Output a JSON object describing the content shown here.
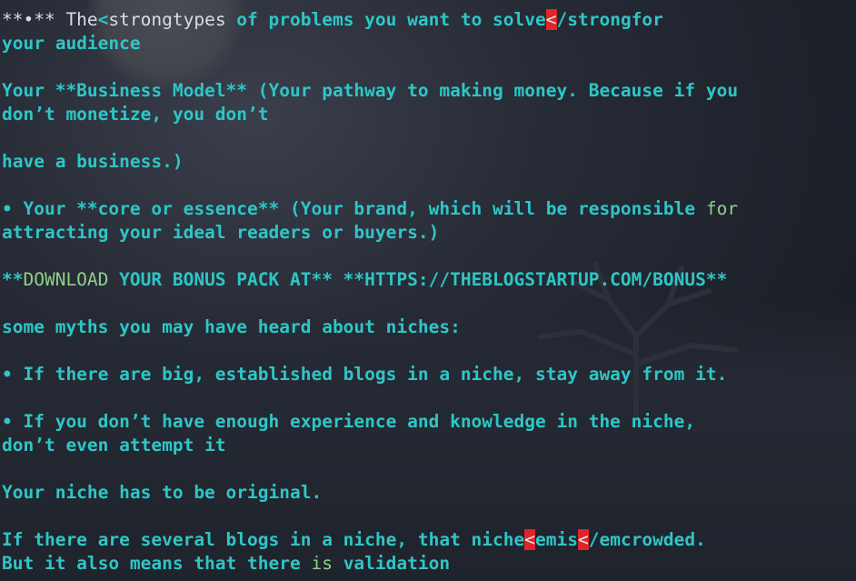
{
  "terminal": {
    "lines": [
      [
        {
          "t": "**•** The",
          "c": "w"
        },
        {
          "t": "<",
          "c": "c"
        },
        {
          "t": "strongtypes",
          "c": "w"
        },
        {
          "t": " of problems you want to solve",
          "c": "c"
        },
        {
          "t": "<",
          "c": "hl"
        },
        {
          "t": "/strongfor",
          "c": "c"
        }
      ],
      [
        {
          "t": "your audience",
          "c": "c"
        }
      ],
      [],
      [
        {
          "t": "Your **Business Model** (Your pathway to making money. Because if you",
          "c": "c"
        }
      ],
      [
        {
          "t": "don’t monetize, you don’t",
          "c": "c"
        }
      ],
      [],
      [
        {
          "t": "have a business.)",
          "c": "c"
        }
      ],
      [],
      [
        {
          "t": "• Your **core or essence** (Your brand, which will be responsible ",
          "c": "c"
        },
        {
          "t": "for",
          "c": "g"
        }
      ],
      [
        {
          "t": "attracting your ideal readers or buyers.)",
          "c": "c"
        }
      ],
      [],
      [
        {
          "t": "**",
          "c": "c"
        },
        {
          "t": "DOWNLOAD",
          "c": "g"
        },
        {
          "t": " YOUR BONUS PACK AT** **HTTPS://THEBLOGSTARTUP.COM/BONUS**",
          "c": "c"
        }
      ],
      [],
      [
        {
          "t": "some myths you may have heard about niches:",
          "c": "c"
        }
      ],
      [],
      [
        {
          "t": "• If there are big, established blogs in a niche, stay away from it.",
          "c": "c"
        }
      ],
      [],
      [
        {
          "t": "• If you don’t have enough experience and knowledge in the niche,",
          "c": "c"
        }
      ],
      [
        {
          "t": "don’t even attempt it",
          "c": "c"
        }
      ],
      [],
      [
        {
          "t": "Your niche has to be original.",
          "c": "c"
        }
      ],
      [],
      [
        {
          "t": "If there are several blogs in a niche, that niche",
          "c": "c"
        },
        {
          "t": "<",
          "c": "hl"
        },
        {
          "t": "emis",
          "c": "c"
        },
        {
          "t": "<",
          "c": "hl"
        },
        {
          "t": "/emcrowded.",
          "c": "c"
        }
      ],
      [
        {
          "t": "But it also means that there ",
          "c": "c"
        },
        {
          "t": "is",
          "c": "g"
        },
        {
          "t": " validation",
          "c": "c"
        }
      ]
    ]
  }
}
